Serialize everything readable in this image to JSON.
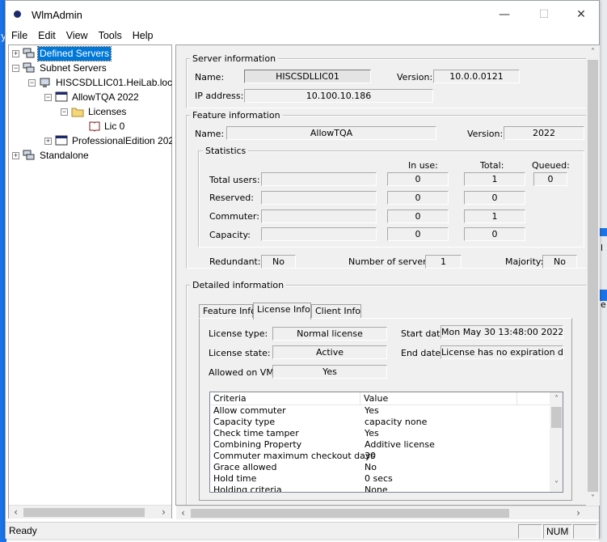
{
  "window": {
    "title": "WlmAdmin",
    "minimize": "—",
    "maximize": "☐",
    "close": "✕"
  },
  "menu": [
    "File",
    "Edit",
    "View",
    "Tools",
    "Help"
  ],
  "tree": {
    "defined_servers": "Defined Servers",
    "subnet_servers": "Subnet Servers",
    "server_host": "HISCSDLLIC01.HeiLab.loc",
    "feature1": "AllowTQA 2022",
    "licenses": "Licenses",
    "lic0": "Lic 0",
    "feature2": "ProfessionalEdition 202",
    "standalone": "Standalone"
  },
  "server_info": {
    "group": "Server information",
    "name_label": "Name:",
    "name_value": "HISCSDLLIC01",
    "version_label": "Version:",
    "version_value": "10.0.0.0121",
    "ip_label": "IP address:",
    "ip_value": "10.100.10.186"
  },
  "feature_info": {
    "group": "Feature information",
    "name_label": "Name:",
    "name_value": "AllowTQA",
    "version_label": "Version:",
    "version_value": "2022"
  },
  "statistics": {
    "group": "Statistics",
    "col_inuse": "In use:",
    "col_total": "Total:",
    "col_queued": "Queued:",
    "rows": [
      {
        "label": "Total users:",
        "inuse": "0",
        "total": "1",
        "queued": "0"
      },
      {
        "label": "Reserved:",
        "inuse": "0",
        "total": "0"
      },
      {
        "label": "Commuter:",
        "inuse": "0",
        "total": "1"
      },
      {
        "label": "Capacity:",
        "inuse": "0",
        "total": "0"
      }
    ],
    "redundant_label": "Redundant:",
    "redundant_value": "No",
    "num_servers_label": "Number of servers:",
    "num_servers_value": "1",
    "majority_label": "Majority:",
    "majority_value": "No"
  },
  "detailed": {
    "group": "Detailed information",
    "tabs": [
      "Feature Info",
      "License Info",
      "Client Info"
    ],
    "license_type_label": "License type:",
    "license_type_value": "Normal license",
    "start_date_label": "Start date:",
    "start_date_value": "Mon May 30 13:48:00 2022",
    "license_state_label": "License state:",
    "license_state_value": "Active",
    "end_date_label": "End date:",
    "end_date_value": "License has no expiration date.",
    "allowed_vm_label": "Allowed on VM:",
    "allowed_vm_value": "Yes",
    "table_headers": [
      "Criteria",
      "Value"
    ],
    "table_rows": [
      [
        "Allow commuter",
        "Yes"
      ],
      [
        "Capacity type",
        "capacity none"
      ],
      [
        "Check time tamper",
        "Yes"
      ],
      [
        "Combining Property",
        "Additive license"
      ],
      [
        "Commuter maximum checkout days",
        "30"
      ],
      [
        "Grace allowed",
        "No"
      ],
      [
        "Hold time",
        "0 secs"
      ],
      [
        "Holding criteria",
        "None"
      ]
    ]
  },
  "status": {
    "text": "Ready",
    "num": "NUM"
  }
}
